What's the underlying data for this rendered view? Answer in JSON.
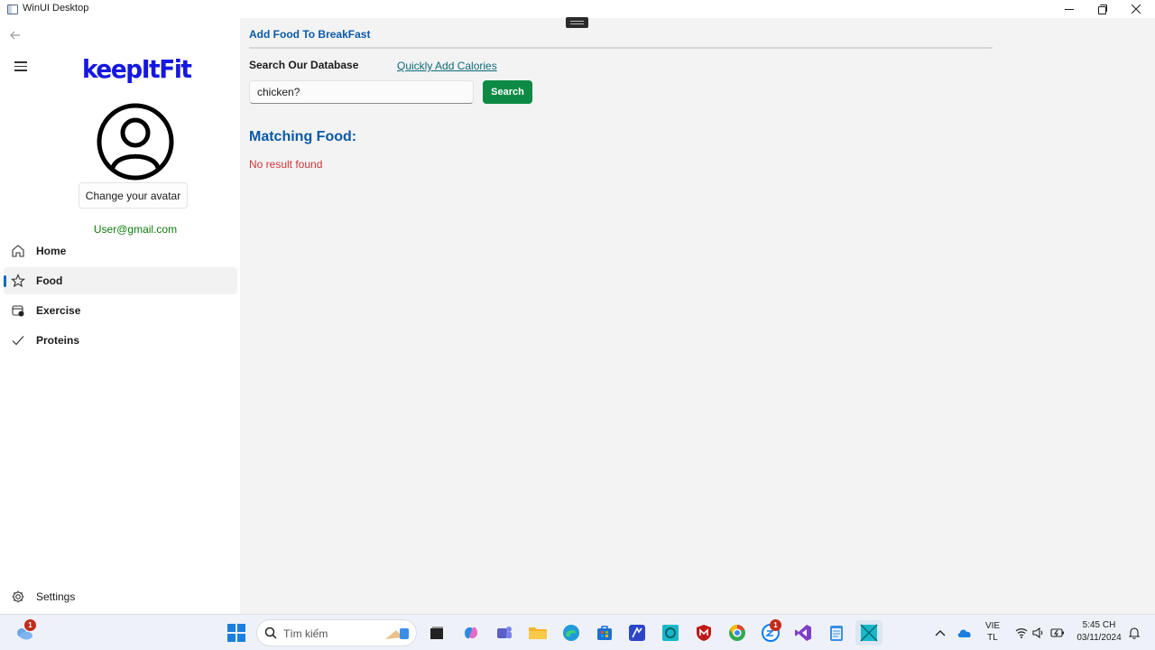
{
  "window": {
    "title": "WinUI Desktop"
  },
  "sidebar": {
    "logo": "keepItFit",
    "change_avatar_label": "Change your avatar",
    "user_email": "User@gmail.com",
    "items": [
      {
        "label": "Home",
        "icon": "home-icon",
        "selected": false
      },
      {
        "label": "Food",
        "icon": "star-icon",
        "selected": true
      },
      {
        "label": "Exercise",
        "icon": "exercise-icon",
        "selected": false
      },
      {
        "label": "Proteins",
        "icon": "checkmark-icon",
        "selected": false
      }
    ],
    "settings_label": "Settings"
  },
  "main": {
    "heading": "Add Food To BreakFast",
    "search_label": "Search Our Database",
    "quick_add_link": "Quickly Add Calories",
    "search_value": "chicken?",
    "search_button": "Search",
    "matching_title": "Matching Food:",
    "no_result": "No result found"
  },
  "taskbar": {
    "search_placeholder": "Tìm kiếm",
    "widgets_badge": "1",
    "zalo_badge": "1",
    "language_top": "VIE",
    "language_bottom": "TL",
    "time": "5:45 CH",
    "date": "03/11/2024"
  },
  "colors": {
    "accent": "#0b5aa7",
    "logo": "#1518e0",
    "search_button": "#0d8a44",
    "error": "#d13438",
    "email": "#0f7b0f",
    "content_bg": "#f3f3f3"
  }
}
